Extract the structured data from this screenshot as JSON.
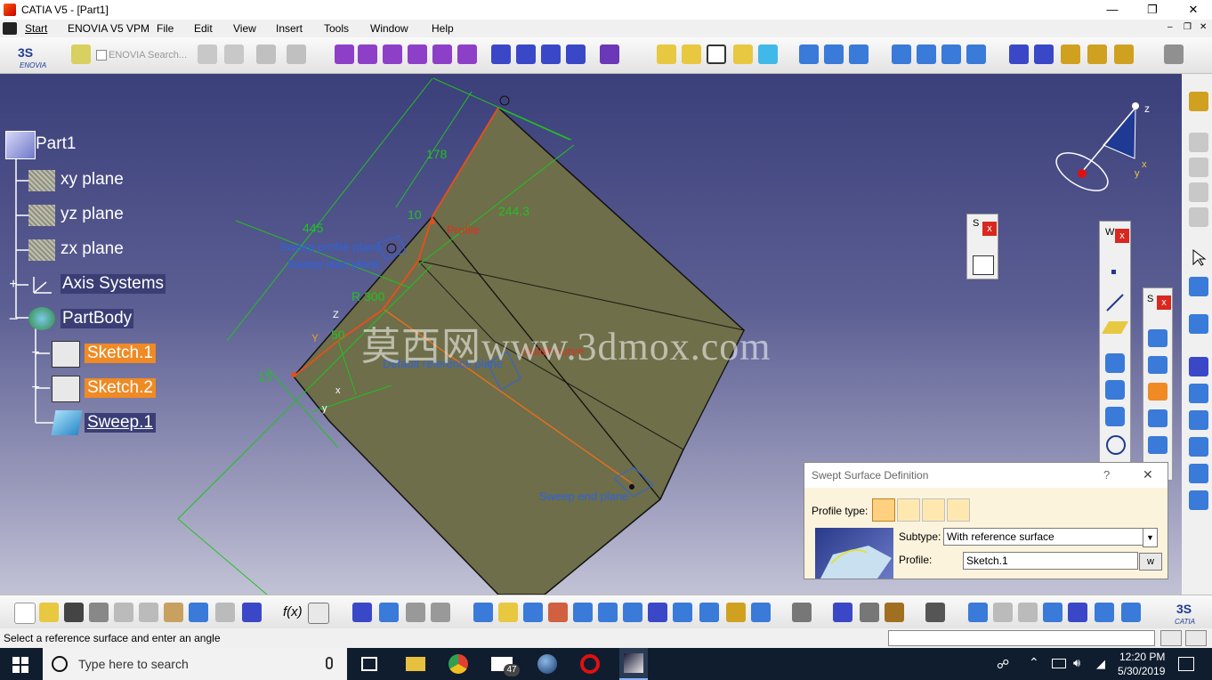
{
  "window": {
    "title": "CATIA V5 - [Part1]",
    "minimize": "—",
    "restore": "❐",
    "close": "✕"
  },
  "menu": {
    "items": [
      "Start",
      "ENOVIA V5 VPM",
      "File",
      "Edit",
      "View",
      "Insert",
      "Tools",
      "Window",
      "Help"
    ]
  },
  "toolbar": {
    "enovia_search_placeholder": "ENOVIA Search..."
  },
  "tree": {
    "root": "Part1",
    "items": [
      "xy plane",
      "yz plane",
      "zx plane",
      "Axis Systems",
      "PartBody",
      "Sketch.1",
      "Sketch.2",
      "Sweep.1"
    ]
  },
  "geometry_labels": {
    "dim_178": "178",
    "dim_445": "445",
    "dim_10": "10",
    "dim_r300": "R 300",
    "dim_50": "50",
    "dim_15": "15",
    "dim_2443": "244.3",
    "profile": "Profile",
    "guide_curve": "Guide curve",
    "sweep_profile_plane": "Sweep profile plane",
    "sweep_start_plane": "Sweep start plane",
    "default_reference_plane": "Default reference plane",
    "sweep_end_plane": "Sweep end plane",
    "axis_z": "Z",
    "axis_y": "Y",
    "axis_x": "x",
    "axis_y2": "y",
    "compass_z": "z",
    "compass_x": "x",
    "compass_y": "y"
  },
  "watermark": "莫西网www.3dmox.com",
  "floating_toolbars": {
    "sketch_tb": "S",
    "wire_tb": "W",
    "surf_tb": "S",
    "close": "x"
  },
  "dialog": {
    "title": "Swept Surface Definition",
    "help": "?",
    "close": "✕",
    "profile_type_label": "Profile type:",
    "subtype_label": "Subtype:",
    "subtype_value": "With reference surface",
    "profile_label": "Profile:",
    "profile_value": "Sketch.1",
    "profile_button": "w"
  },
  "status": {
    "message": "Select a reference surface and enter an angle"
  },
  "taskbar": {
    "search_placeholder": "Type here to search",
    "time": "12:20 PM",
    "date": "5/30/2019",
    "mail_badge": "47"
  },
  "colors": {
    "surface": "#6e6e4a",
    "dimension": "#22c022",
    "label_blue": "#2d63e0",
    "highlight": "#f08a24",
    "profile": "#e03020"
  }
}
